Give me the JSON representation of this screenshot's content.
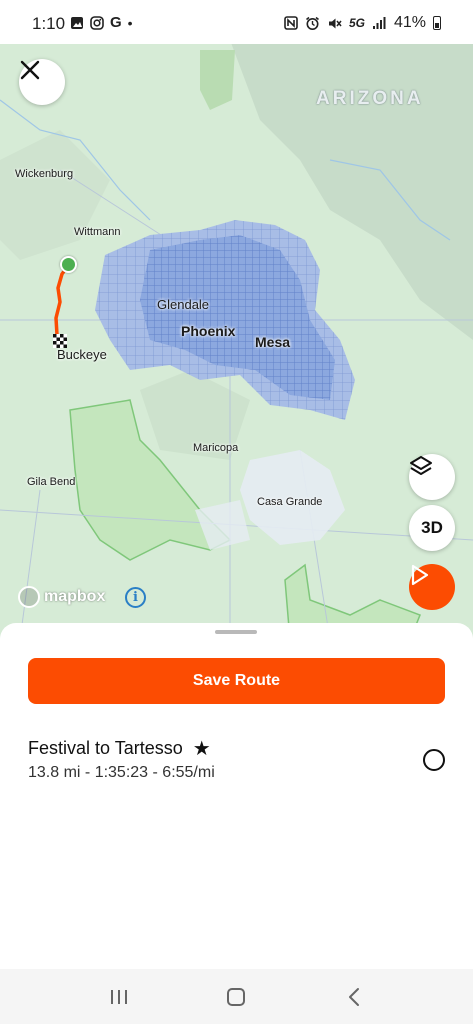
{
  "status_bar": {
    "time": "1:10",
    "network": "5G",
    "battery": "41%",
    "left_icons": [
      "image-icon",
      "instagram-icon",
      "google-icon",
      "dot-icon"
    ],
    "right_icons": [
      "nfc-icon",
      "alarm-icon",
      "mute-icon",
      "signal-icon",
      "battery-icon"
    ]
  },
  "map": {
    "state_label": "ARIZONA",
    "places": {
      "wickenburg": "Wickenburg",
      "wittmann": "Wittmann",
      "glendale": "Glendale",
      "phoenix": "Phoenix",
      "mesa": "Mesa",
      "buckeye": "Buckeye",
      "maricopa": "Maricopa",
      "gila_bend": "Gila Bend",
      "casa_grande": "Casa Grande"
    },
    "attribution": "mapbox",
    "btn_3d": "3D",
    "colors": {
      "route": "#fc4c02",
      "start_marker": "#4caf50",
      "urban": "#6a8fd0"
    }
  },
  "sheet": {
    "save_label": "Save Route",
    "route_title": "Festival to Tartesso",
    "route_stats": "13.8 mi - 1:35:23 - 6:55/mi"
  },
  "nav": {
    "icons": [
      "recents-icon",
      "home-icon",
      "back-icon"
    ]
  },
  "accent_color": "#fc4c02"
}
